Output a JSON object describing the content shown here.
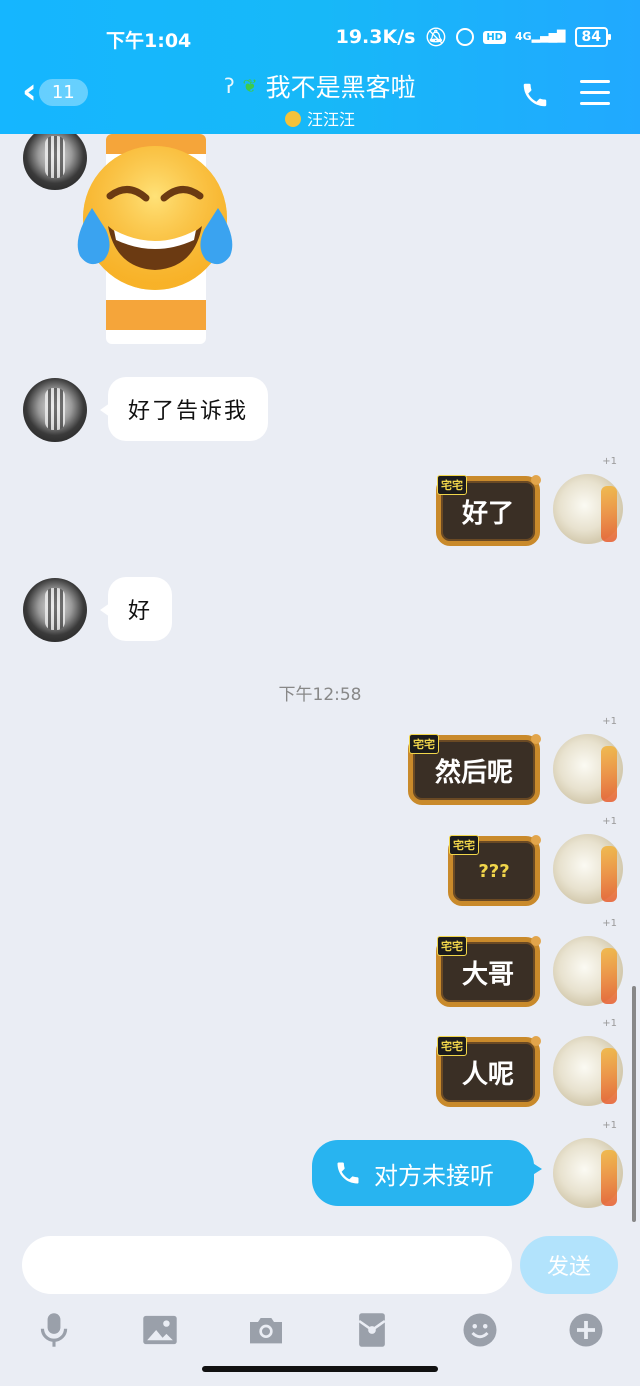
{
  "status_bar": {
    "time": "下午1:04",
    "speed": "19.3K/s",
    "hd": "HD",
    "network": "4G",
    "battery": "84"
  },
  "header": {
    "back_badge": "11",
    "title": "我不是黑客啦",
    "subtitle": "汪汪汪"
  },
  "messages": {
    "m1_text": "好了告诉我",
    "s1_text": "好了",
    "m2_text": "好",
    "timestamp": "下午12:58",
    "s2_text": "然后呢",
    "s3_text": "???",
    "s4_text": "大哥",
    "s5_text": "人呢",
    "call_text": "对方未接听",
    "sticker_tag": "宅宅",
    "plus_one": "+1"
  },
  "input": {
    "placeholder": "",
    "send_label": "发送"
  },
  "icons": {
    "back": "chevron-left-icon",
    "phone": "phone-icon",
    "menu": "menu-icon",
    "voice": "microphone-icon",
    "image": "image-icon",
    "camera": "camera-icon",
    "red_packet": "red-packet-icon",
    "emoji": "emoji-icon",
    "more": "plus-icon"
  },
  "colors": {
    "header": "#17b8f8",
    "call_bubble": "#28b4f0",
    "send_disabled": "#b2e3fc",
    "background": "#eaedf4"
  }
}
